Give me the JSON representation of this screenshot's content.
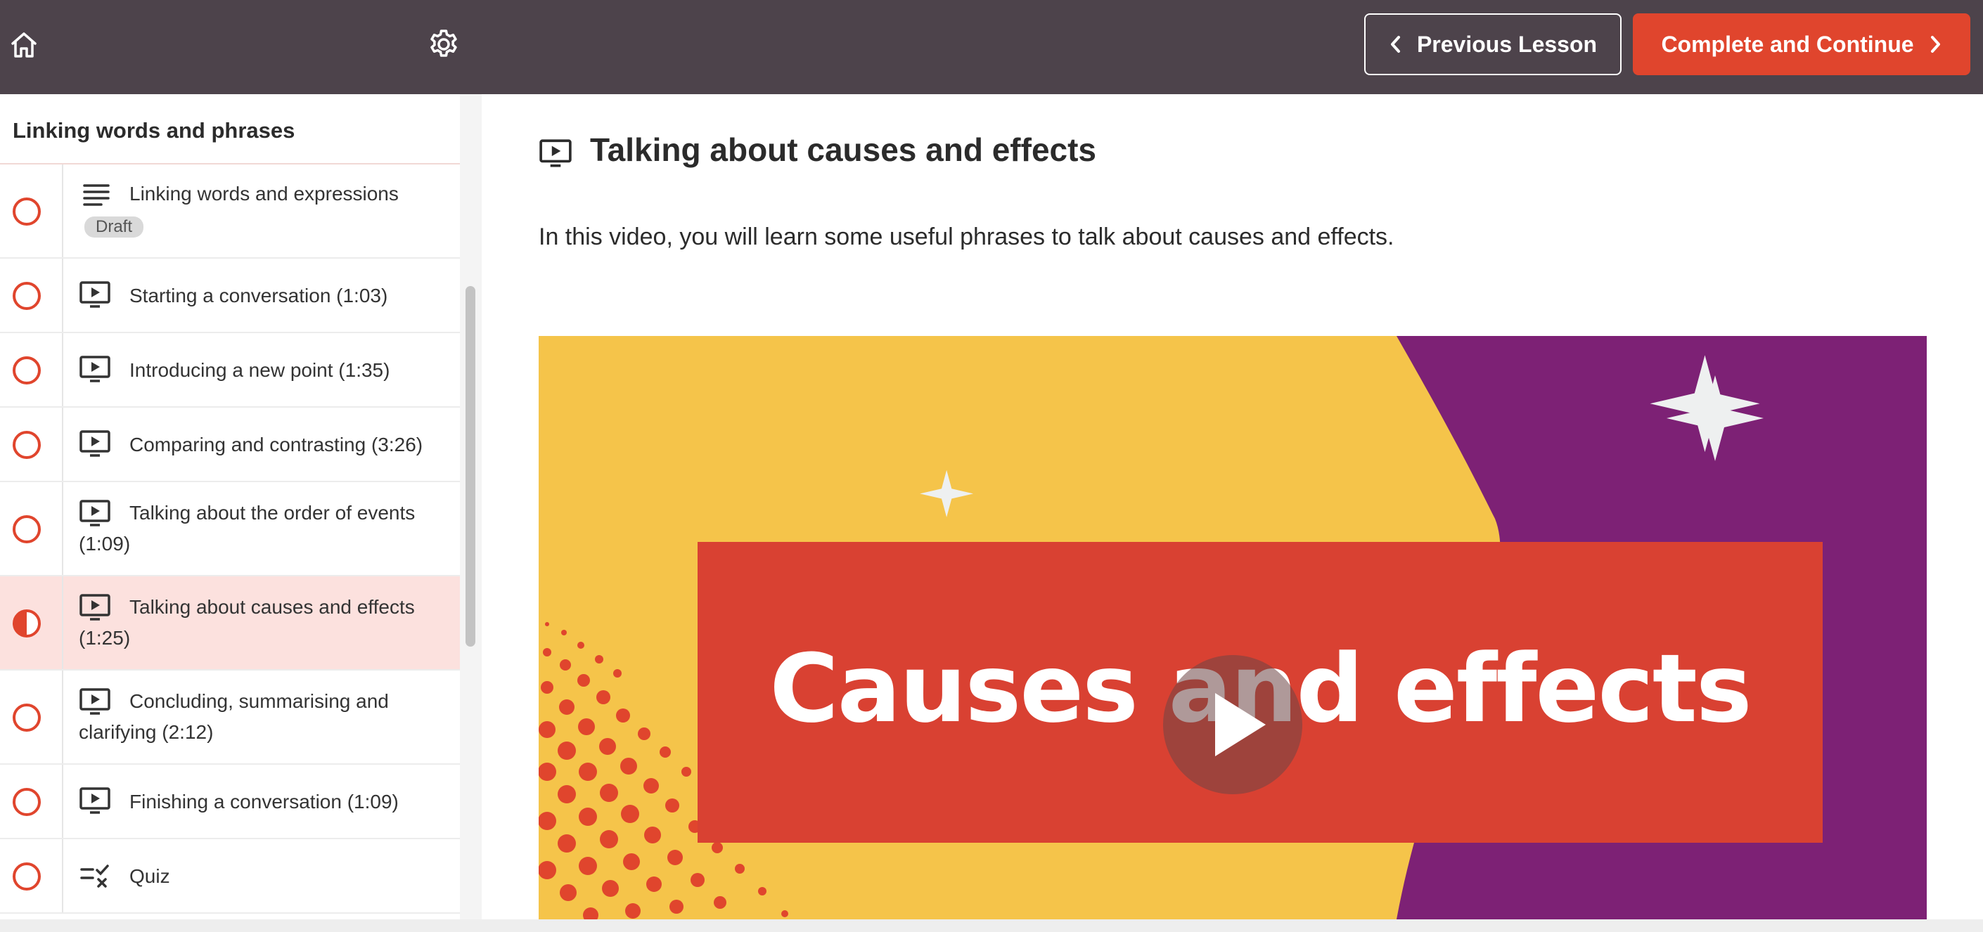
{
  "sidebar": {
    "section_title": "Linking words and phrases",
    "lessons": [
      {
        "label": "Linking words and expressions",
        "icon": "text-lines-icon",
        "status": "incomplete",
        "badge": "Draft"
      },
      {
        "label": "Starting a conversation (1:03)",
        "icon": "video-icon",
        "status": "incomplete"
      },
      {
        "label": "Introducing a new point (1:35)",
        "icon": "video-icon",
        "status": "incomplete"
      },
      {
        "label": "Comparing and contrasting (3:26)",
        "icon": "video-icon",
        "status": "incomplete"
      },
      {
        "label": "Talking about the order of events (1:09)",
        "icon": "video-icon",
        "status": "incomplete"
      },
      {
        "label": "Talking about causes and effects (1:25)",
        "icon": "video-icon",
        "status": "in-progress",
        "active": true
      },
      {
        "label": "Concluding, summarising and clarifying (2:12)",
        "icon": "video-icon",
        "status": "incomplete"
      },
      {
        "label": "Finishing a conversation (1:09)",
        "icon": "video-icon",
        "status": "incomplete"
      },
      {
        "label": "Quiz",
        "icon": "quiz-icon",
        "status": "incomplete"
      }
    ]
  },
  "topbar": {
    "prev_label": "Previous Lesson",
    "next_label": "Complete and Continue"
  },
  "lesson": {
    "title": "Talking about causes and effects",
    "description": "In this video, you will learn some useful phrases to talk about causes and effects.",
    "video_banner_text": "Causes and effects"
  },
  "colors": {
    "header_bg": "#4d434b",
    "accent": "#e0452d",
    "active_row_bg": "#fce1de",
    "video_yellow": "#f5c44a",
    "video_purple": "#7d2175",
    "video_banner": "#d94132"
  }
}
